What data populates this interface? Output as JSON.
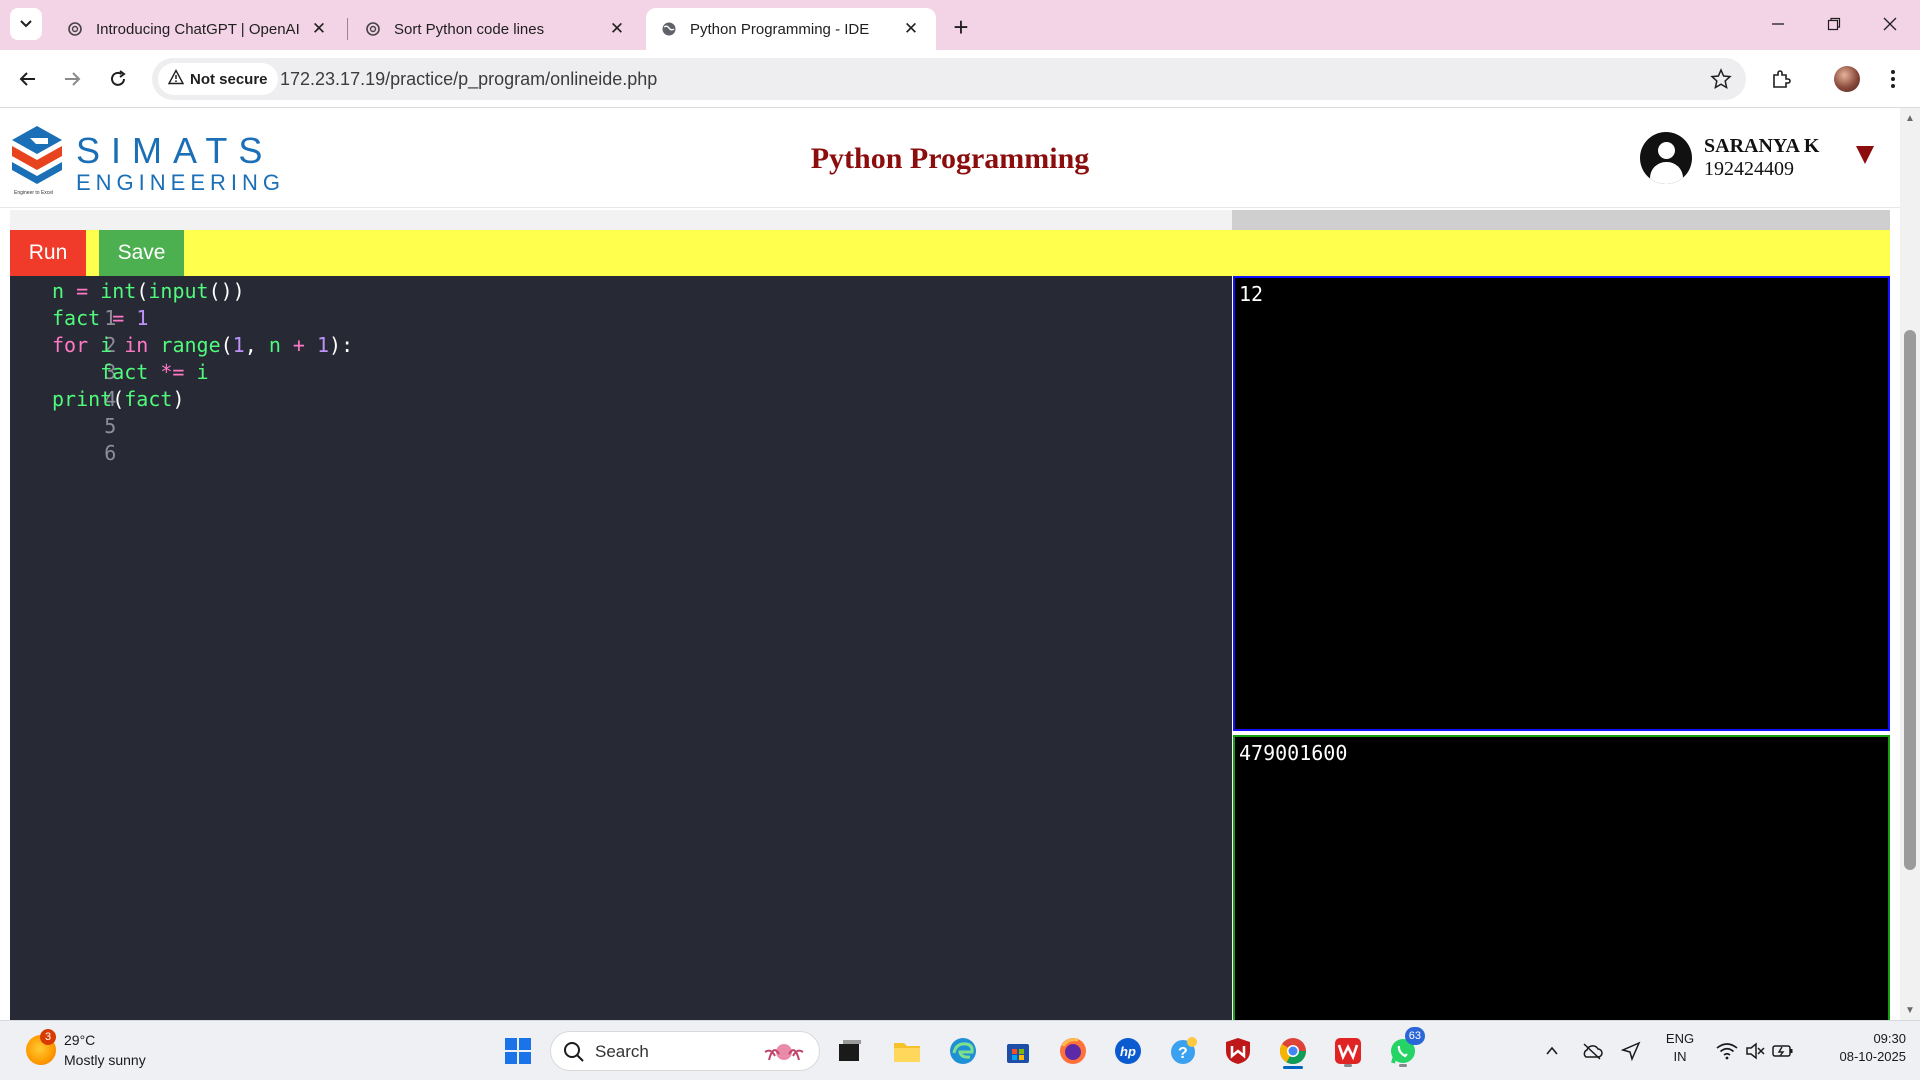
{
  "browser": {
    "tabs": [
      {
        "title": "Introducing ChatGPT | OpenAI",
        "icon": "openai-icon",
        "active": false
      },
      {
        "title": "Sort Python code lines",
        "icon": "openai-icon",
        "active": false
      },
      {
        "title": "Python Programming - IDE",
        "icon": "globe-icon",
        "active": true
      }
    ],
    "security_label": "Not secure",
    "url": "172.23.17.19/practice/p_program/onlineide.php"
  },
  "header": {
    "logo_line1": "SIMATS",
    "logo_line2": "ENGINEERING",
    "logo_tagline": "Engineer to Excel",
    "title": "Python Programming",
    "user_name": "SARANYA K",
    "user_id": "192424409"
  },
  "actions": {
    "run_label": "Run",
    "save_label": "Save"
  },
  "editor": {
    "line_numbers": [
      "1",
      "2",
      "3",
      "4",
      "5",
      "6"
    ],
    "lines": [
      "n = int(input())",
      "fact = 1",
      "for i in range(1, n + 1):",
      "    fact *= i",
      "print(fact)",
      ""
    ]
  },
  "io": {
    "input": "12",
    "output": "479001600"
  },
  "taskbar": {
    "weather_temp": "29°C",
    "weather_desc": "Mostly sunny",
    "weather_badge": "3",
    "search_placeholder": "Search",
    "whatsapp_badge": "63",
    "lang_line1": "ENG",
    "lang_line2": "IN",
    "time": "09:30",
    "date": "08-10-2025"
  },
  "colors": {
    "tabstrip": "#f3d3e6",
    "title": "#8b0d0d",
    "run_button": "#f03a2a",
    "save_button": "#4caf50",
    "action_bar": "#ffff4d",
    "editor_bg": "#272935",
    "input_border": "#1010ff",
    "output_border": "#12a012"
  }
}
